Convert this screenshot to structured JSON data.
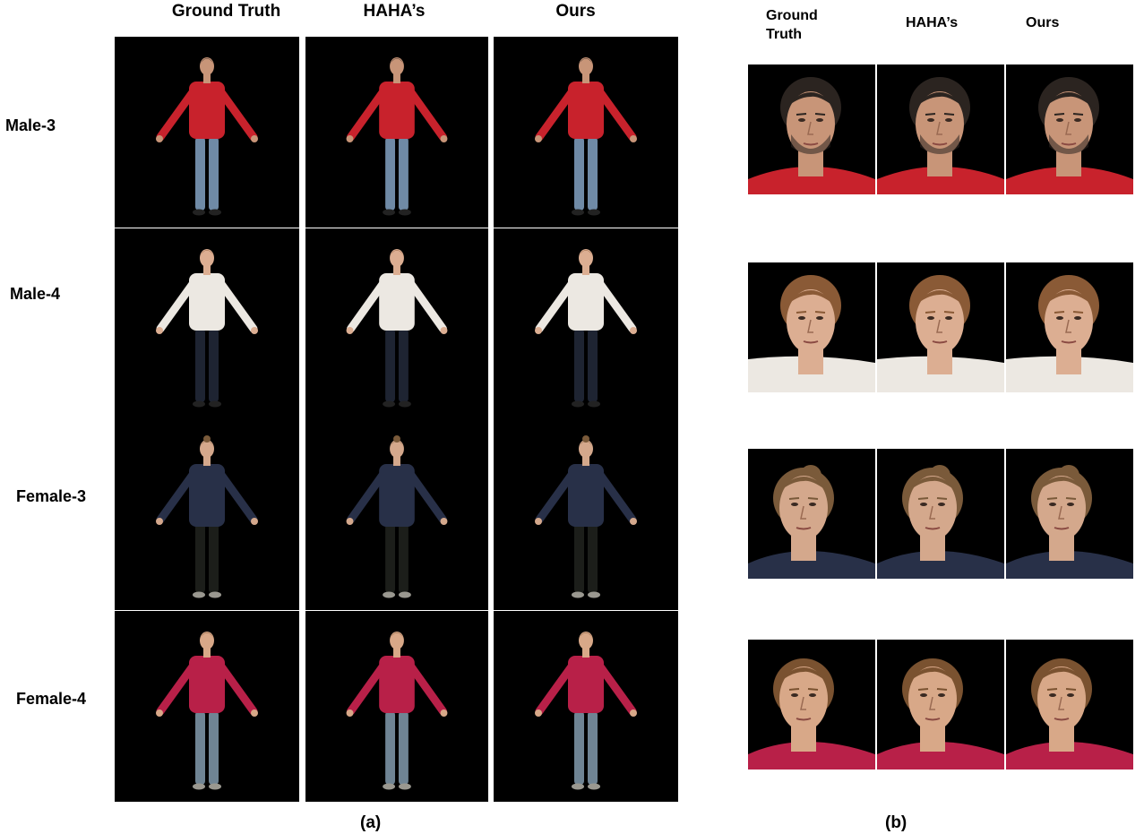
{
  "panel_a": {
    "columns": [
      "Ground Truth",
      "HAHA’s",
      "Ours"
    ],
    "rows": [
      {
        "label": "Male-3",
        "shirt": "#c8222c",
        "pants": "#6f8aa6",
        "hair": "#2b2420",
        "skin": "#c89578"
      },
      {
        "label": "Male-4",
        "shirt": "#ece8e2",
        "pants": "#1e2432",
        "hair": "#8a5a36",
        "skin": "#dcae92"
      },
      {
        "label": "Female-3",
        "shirt": "#283048",
        "pants": "#1c1e1a",
        "hair": "#7a5a3a",
        "skin": "#d4a88c"
      },
      {
        "label": "Female-4",
        "shirt": "#b82048",
        "pants": "#6f8494",
        "hair": "#7a5230",
        "skin": "#d8a888"
      }
    ],
    "caption": "(a)"
  },
  "panel_b": {
    "columns": [
      "Ground\nTruth",
      "HAHA’s",
      "Ours"
    ],
    "caption": "(b)"
  }
}
